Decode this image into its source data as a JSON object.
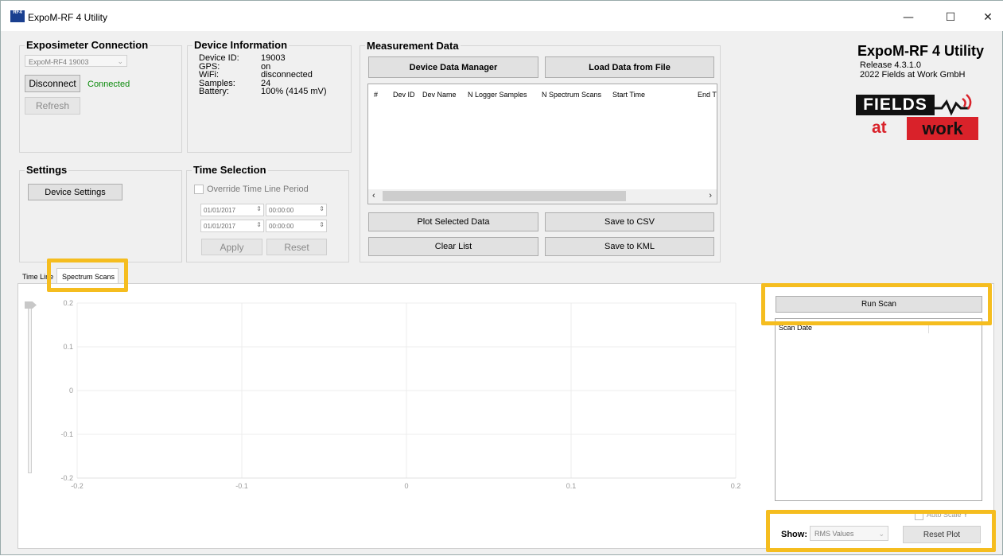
{
  "window": {
    "title": "ExpoM-RF 4 Utility",
    "icon_text": "RF4",
    "minimize": "—",
    "maximize": "☐",
    "close": "✕"
  },
  "connection": {
    "title": "Exposimeter Connection",
    "device_select": "ExpoM-RF4 19003",
    "disconnect_label": "Disconnect",
    "status": "Connected",
    "status_color": "#0a8a0a",
    "refresh_label": "Refresh"
  },
  "device_info": {
    "title": "Device Information",
    "rows": [
      {
        "key": "Device ID:",
        "value": "19003"
      },
      {
        "key": "GPS:",
        "value": "on"
      },
      {
        "key": "WiFi:",
        "value": "disconnected"
      },
      {
        "key": "Samples:",
        "value": "24"
      },
      {
        "key": "Battery:",
        "value": "100% (4145 mV)"
      }
    ]
  },
  "settings": {
    "title": "Settings",
    "device_settings_label": "Device Settings"
  },
  "time_selection": {
    "title": "Time Selection",
    "override_label": "Override Time Line Period",
    "start_date": "01/01/2017",
    "start_time": "00:00:00",
    "end_date": "01/01/2017",
    "end_time": "00:00:00",
    "apply_label": "Apply",
    "reset_label": "Reset"
  },
  "measurement": {
    "title": "Measurement Data",
    "manager_label": "Device Data Manager",
    "load_label": "Load Data from File",
    "columns": [
      "#",
      "Dev ID",
      "Dev Name",
      "N Logger Samples",
      "N Spectrum Scans",
      "Start Time",
      "End T"
    ],
    "plot_label": "Plot Selected Data",
    "csv_label": "Save to CSV",
    "clear_label": "Clear List",
    "kml_label": "Save to KML"
  },
  "branding": {
    "app_name": "ExpoM-RF 4 Utility",
    "release": "Release 4.3.1.0",
    "copyright": "2022 Fields at Work GmbH",
    "logo_word1": "FIELDS",
    "logo_word2": "at",
    "logo_word3": "work",
    "logo_red": "#d9222a"
  },
  "tabs": [
    {
      "label": "Time Line"
    },
    {
      "label": "Spectrum Scans"
    }
  ],
  "spectrum": {
    "run_scan_label": "Run Scan",
    "scan_date_header": "Scan Date",
    "auto_scale_label": "Auto Scale Y",
    "show_label": "Show:",
    "show_value": "RMS Values",
    "reset_plot_label": "Reset Plot"
  },
  "chart_data": {
    "type": "line",
    "title": "",
    "xlabel": "",
    "ylabel": "",
    "xlim": [
      -0.2,
      0.2
    ],
    "ylim": [
      -0.2,
      0.2
    ],
    "x_ticks": [
      "-0.2",
      "-0.1",
      "0",
      "0.1",
      "0.2"
    ],
    "y_ticks": [
      "0.2",
      "0.1",
      "0",
      "-0.1",
      "-0.2"
    ],
    "grid": true,
    "series": []
  },
  "highlight_color": "#f5bd1f"
}
